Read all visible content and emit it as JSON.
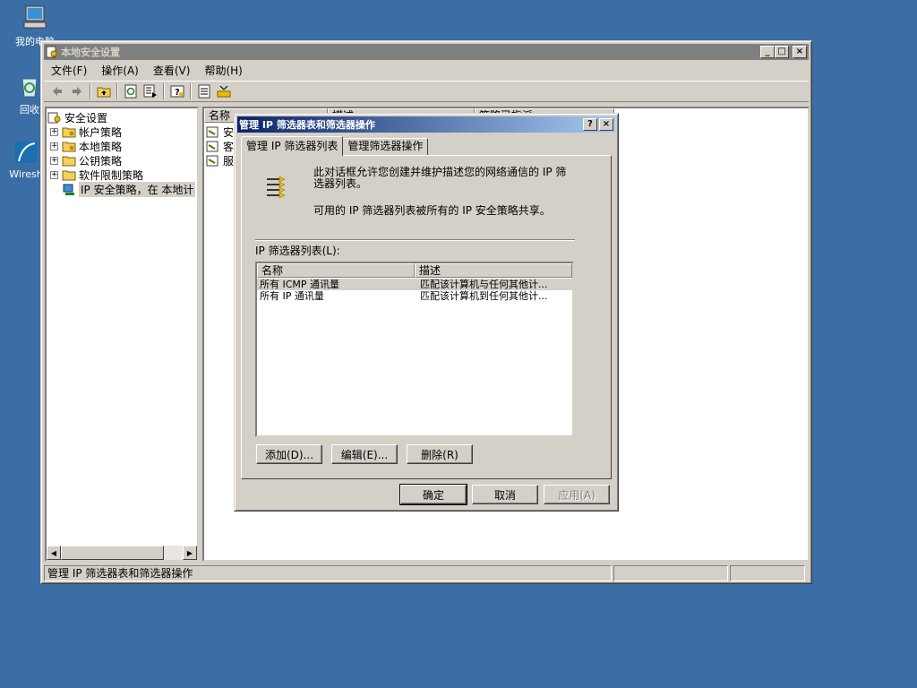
{
  "desktop": {
    "icons": [
      {
        "label": "我的电脑",
        "icon": "my-computer-icon"
      },
      {
        "label": "回收",
        "icon": "recycle-bin-icon"
      },
      {
        "label": "Wiresh",
        "icon": "wireshark-icon"
      }
    ]
  },
  "main_window": {
    "title": "本地安全设置",
    "menu": [
      "文件(F)",
      "操作(A)",
      "查看(V)",
      "帮助(H)"
    ],
    "toolbar_icons": [
      "back-icon",
      "forward-icon",
      "up-folder-icon",
      "refresh-icon",
      "export-list-icon",
      "help-icon",
      "properties-icon",
      "policy-icon"
    ],
    "tree": {
      "root": "安全设置",
      "items": [
        "帐户策略",
        "本地策略",
        "公钥策略",
        "软件限制策略",
        "IP 安全策略，在 本地计"
      ]
    },
    "list_columns": [
      "名称",
      "描述",
      "策略已指派"
    ],
    "list_items": [
      "安全",
      "客户",
      "服务"
    ],
    "status_text": "管理 IP 筛选器表和筛选器操作"
  },
  "dialog": {
    "title": "管理 IP 筛选器表和筛选器操作",
    "help_button": "?",
    "close_button": "×",
    "tabs": [
      "管理 IP 筛选器列表",
      "管理筛选器操作"
    ],
    "description_line1": "此对话框允许您创建并维护描述您的网络通信的 IP 筛",
    "description_line2": "选器列表。",
    "shared_note": "可用的 IP 筛选器列表被所有的 IP 安全策略共享。",
    "list_label": "IP 筛选器列表(L):",
    "columns": [
      "名称",
      "描述"
    ],
    "rows": [
      {
        "name": "所有 ICMP 通讯量",
        "description": "匹配该计算机与任何其他计..."
      },
      {
        "name": "所有 IP 通讯量",
        "description": "匹配该计算机到任何其他计..."
      }
    ],
    "buttons": {
      "add": "添加(D)...",
      "edit": "编辑(E)...",
      "remove": "删除(R)"
    },
    "footer": {
      "ok": "确定",
      "cancel": "取消",
      "apply": "应用(A)"
    }
  }
}
